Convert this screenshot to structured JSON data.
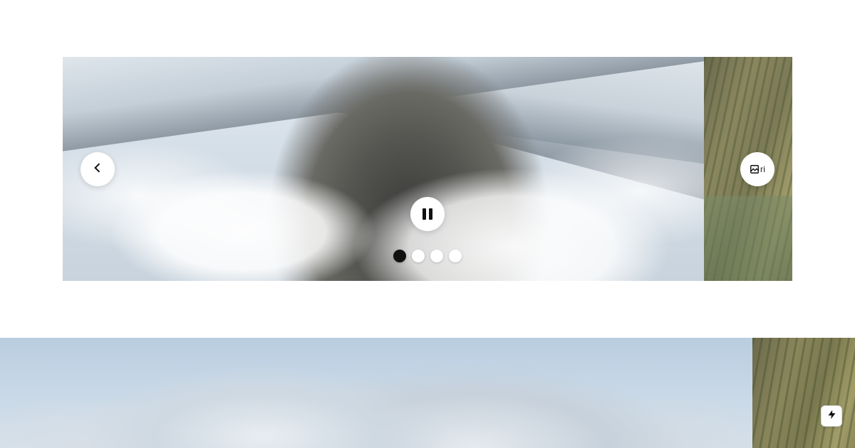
{
  "carousel_top": {
    "prev_aria": "Previous slide",
    "next_aria": "Next slide",
    "next_broken_alt": "ri",
    "pause_aria": "Pause autoplay",
    "slide_count": 4,
    "active_index": 0,
    "dots": [
      {
        "aria": "Go to slide 1"
      },
      {
        "aria": "Go to slide 2"
      },
      {
        "aria": "Go to slide 3"
      },
      {
        "aria": "Go to slide 4"
      }
    ]
  },
  "carousel_bottom": {
    "lightning_aria": "Quick action"
  },
  "colors": {
    "button_bg": "#ffffff",
    "icon_dark": "#111111",
    "dot_inactive": "#ffffff",
    "dot_active": "#111111"
  }
}
